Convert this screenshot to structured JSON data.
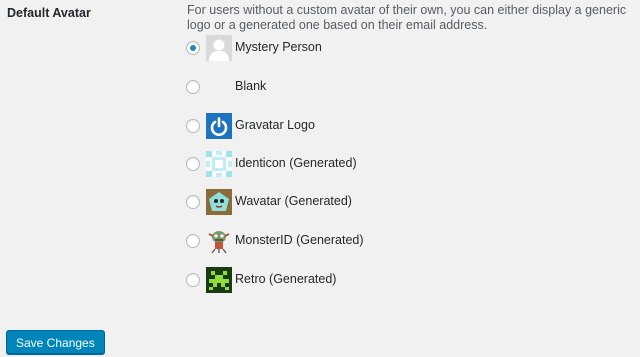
{
  "setting": {
    "label": "Default Avatar",
    "description": "For users without a custom avatar of their own, you can either display a generic logo or a generated one based on their email address."
  },
  "options": [
    {
      "label": "Mystery Person",
      "icon": "mystery-person-icon",
      "selected": true
    },
    {
      "label": "Blank",
      "icon": "blank-avatar-icon",
      "selected": false
    },
    {
      "label": "Gravatar Logo",
      "icon": "gravatar-logo-icon",
      "selected": false
    },
    {
      "label": "Identicon (Generated)",
      "icon": "identicon-icon",
      "selected": false
    },
    {
      "label": "Wavatar (Generated)",
      "icon": "wavatar-icon",
      "selected": false
    },
    {
      "label": "MonsterID (Generated)",
      "icon": "monsterid-icon",
      "selected": false
    },
    {
      "label": "Retro (Generated)",
      "icon": "retro-icon",
      "selected": false
    }
  ],
  "save_button": {
    "label": "Save Changes"
  },
  "colors": {
    "accent": "#0085ba",
    "background": "#f1f1f1",
    "radio_checked": "#1e8cbe"
  }
}
